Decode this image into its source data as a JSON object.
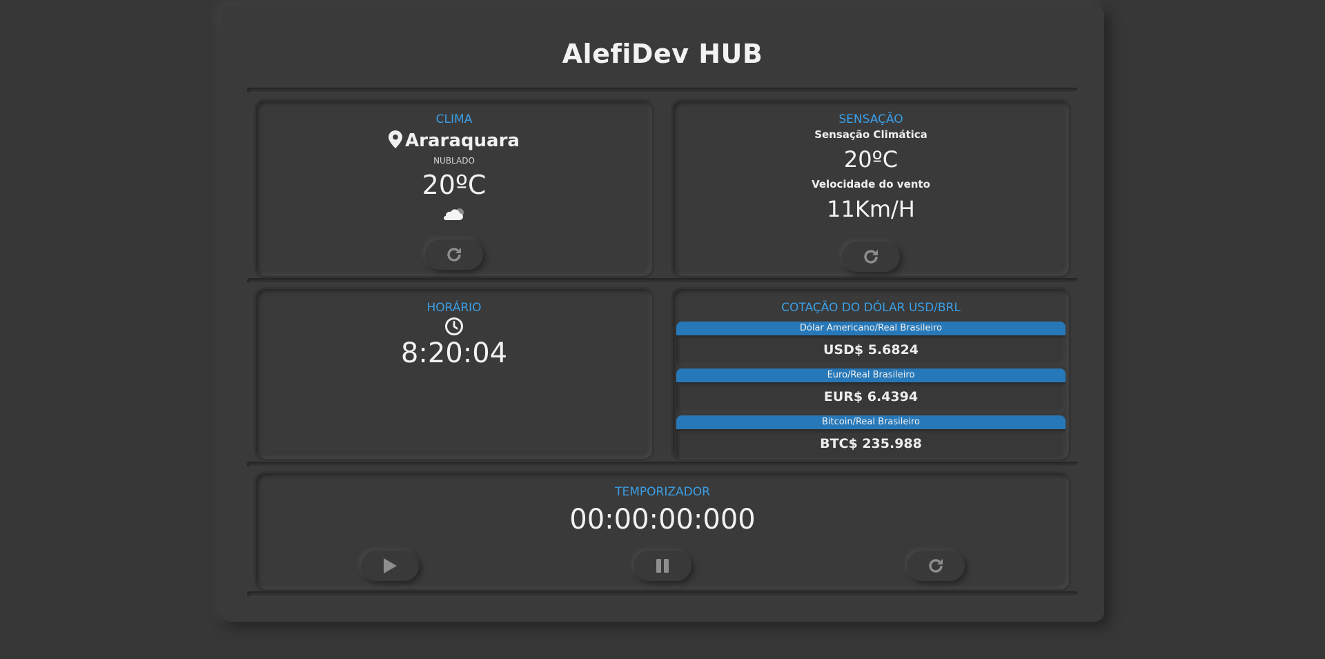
{
  "header": {
    "title": "AlefiDev HUB"
  },
  "weather": {
    "title": "CLIMA",
    "location_icon": "map-pin-icon",
    "city": "Araraquara",
    "condition": "NUBLADO",
    "temperature": "20ºC",
    "weather_icon": "cloud-icon",
    "refresh_icon": "refresh-icon"
  },
  "sensation": {
    "title": "SENSAÇÃO",
    "feels_label": "Sensação Climática",
    "feels_value": "20ºC",
    "wind_label": "Velocidade do vento",
    "wind_value": "11Km/H",
    "refresh_icon": "refresh-icon"
  },
  "clock": {
    "title": "HORÁRIO",
    "clock_icon": "clock-icon",
    "time": "8:20:04"
  },
  "rates": {
    "title": "COTAÇÃO DO DÓLAR USD/BRL",
    "items": [
      {
        "label": "Dólar Americano/Real Brasileiro",
        "value": "USD$ 5.6824"
      },
      {
        "label": "Euro/Real Brasileiro",
        "value": "EUR$ 6.4394"
      },
      {
        "label": "Bitcoin/Real Brasileiro",
        "value": "BTC$ 235.988"
      }
    ]
  },
  "timer": {
    "title": "TEMPORIZADOR",
    "value": "00:00:00:000",
    "play_icon": "play-icon",
    "pause_icon": "pause-icon",
    "reset_icon": "refresh-icon"
  },
  "colors": {
    "background": "#373737",
    "panel": "#3a3a3a",
    "accent": "#3a9fe6",
    "rate_bar": "#2778b8",
    "text": "#e9e9e9"
  }
}
